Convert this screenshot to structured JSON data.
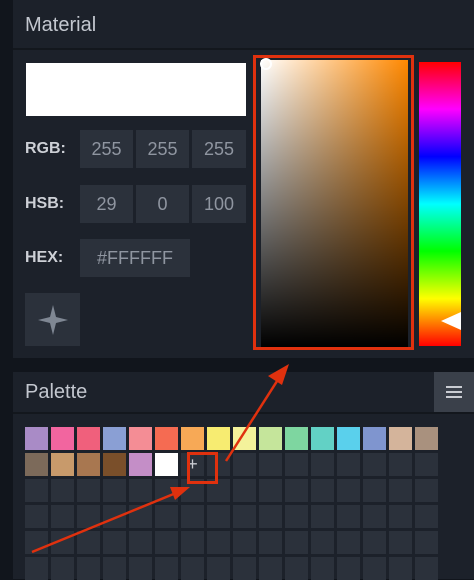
{
  "material": {
    "title": "Material",
    "preview_color": "#FFFFFF",
    "rgb": {
      "label": "RGB:",
      "values": [
        "255",
        "255",
        "255"
      ]
    },
    "hsb": {
      "label": "HSB:",
      "values": [
        "29",
        "0",
        "100"
      ]
    },
    "hex": {
      "label": "HEX:",
      "value": "#FFFFFF"
    },
    "picker": {
      "hue_color": "#FF8800",
      "highlight_color": "#E0310E"
    }
  },
  "palette": {
    "title": "Palette",
    "add_label": "+",
    "swatches_row1": [
      "#a98bc6",
      "#f2659f",
      "#f0607c",
      "#8a9fd4",
      "#f48d95",
      "#f56b52",
      "#f7a956",
      "#f7ec71",
      "#f4f29b",
      "#c5e59b",
      "#7ed6a0",
      "#62d1c5",
      "#5ad0ec",
      "#7f95cf",
      "#d4b49b",
      "#a9917e"
    ],
    "swatches_row2": [
      "#7c6a5a",
      "#c89a6b",
      "#a87750",
      "#7a4f2a",
      "#c48ec7",
      "#ffffff"
    ]
  }
}
